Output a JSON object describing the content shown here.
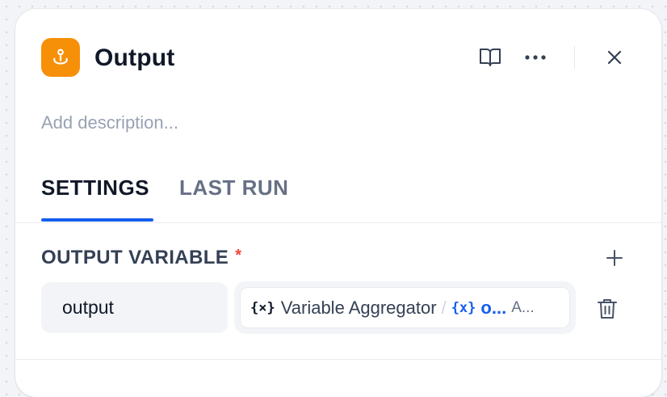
{
  "header": {
    "title": "Output",
    "app_icon": "output-node-icon",
    "actions": [
      "book-icon",
      "more-icon",
      "close-icon"
    ]
  },
  "description": {
    "placeholder": "Add description..."
  },
  "tabs": [
    {
      "label": "SETTINGS",
      "active": true
    },
    {
      "label": "LAST RUN",
      "active": false
    }
  ],
  "output_section": {
    "label": "OUTPUT VARIABLE",
    "required_mark": "*",
    "variables": [
      {
        "name": "output",
        "source_node": "Variable Aggregator",
        "separator": "/",
        "variable": "o...",
        "type": "A..."
      }
    ]
  },
  "colors": {
    "accent": "#155eef",
    "app_icon_bg": "#f79009",
    "required": "#f04438"
  }
}
